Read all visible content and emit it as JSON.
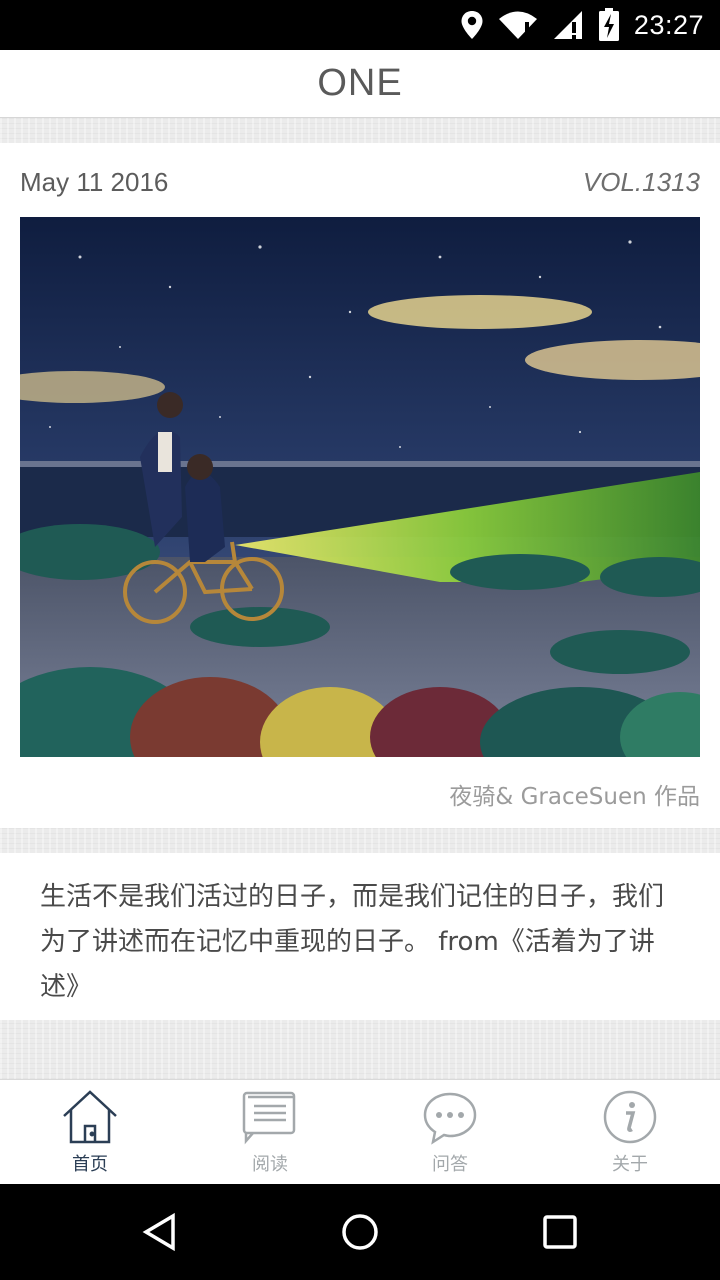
{
  "status_bar": {
    "time": "23:27",
    "icons": [
      "location-icon",
      "wifi-icon",
      "cellular-signal-icon",
      "battery-charging-icon"
    ]
  },
  "header": {
    "title": "ONE"
  },
  "card": {
    "date": "May 11 2016",
    "vol": "VOL.1313",
    "credit": "夜骑& GraceSuen 作品"
  },
  "quote": {
    "text": "生活不是我们活过的日子，而是我们记住的日子，我们为了讲述而在记忆中重现的日子。 from《活着为了讲述》"
  },
  "tabs": [
    {
      "label": "首页",
      "icon": "home-icon",
      "active": true
    },
    {
      "label": "阅读",
      "icon": "reading-icon",
      "active": false
    },
    {
      "label": "问答",
      "icon": "chat-bubble-icon",
      "active": false
    },
    {
      "label": "关于",
      "icon": "info-icon",
      "active": false
    }
  ],
  "colors": {
    "active_tab": "#2b3e55",
    "inactive_tab": "#a3a8ab",
    "header_text": "#5a5a5a",
    "background": "#ebebeb"
  },
  "nav": {
    "buttons": [
      "back-icon",
      "home-circle-icon",
      "recents-icon"
    ]
  }
}
